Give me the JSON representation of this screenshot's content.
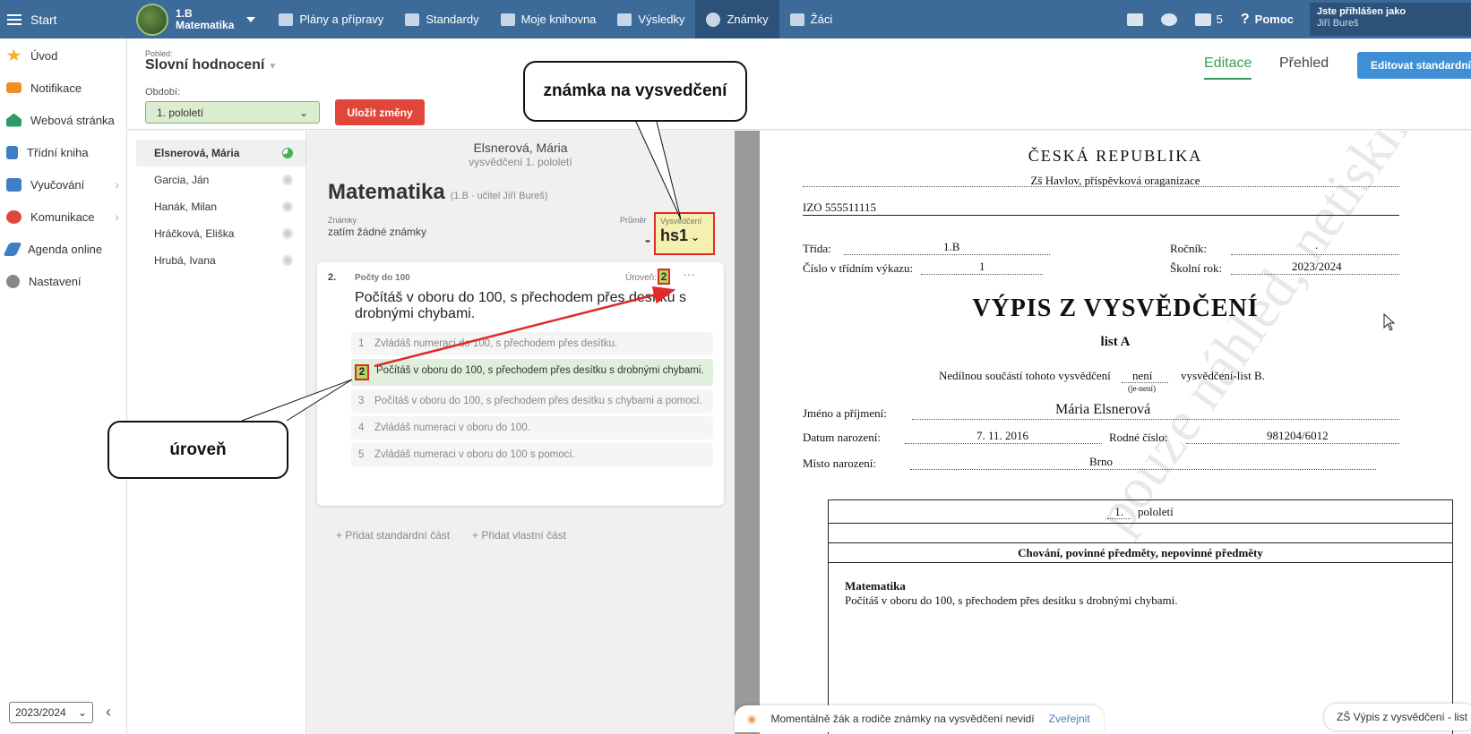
{
  "topbar": {
    "start": "Start",
    "class_name": "1.B",
    "class_subject": "Matematika",
    "nav": [
      {
        "label": "Plány a přípravy",
        "icon": "calendar-icon"
      },
      {
        "label": "Standardy",
        "icon": "shield-icon"
      },
      {
        "label": "Moje knihovna",
        "icon": "library-icon"
      },
      {
        "label": "Výsledky",
        "icon": "bar-chart-icon"
      },
      {
        "label": "Známky",
        "icon": "grade-icon"
      },
      {
        "label": "Žáci",
        "icon": "students-icon"
      }
    ],
    "messages_count": "5",
    "help": "Pomoc",
    "user_label": "Jste přihlášen jako",
    "user_name": "Jiří Bureš"
  },
  "sidebar": {
    "items": [
      {
        "label": "Úvod",
        "icon": "star-icon",
        "color": "#f0b429"
      },
      {
        "label": "Notifikace",
        "icon": "envelope-icon",
        "color": "#f08c2a"
      },
      {
        "label": "Webová stránka",
        "icon": "home-icon",
        "color": "#2e9a6a"
      },
      {
        "label": "Třídní kniha",
        "icon": "book-icon",
        "color": "#3f7fc6"
      },
      {
        "label": "Vyučování",
        "icon": "open-book-icon",
        "color": "#3f7fc6"
      },
      {
        "label": "Komunikace",
        "icon": "chat-icon",
        "color": "#e0463a"
      },
      {
        "label": "Agenda online",
        "icon": "pen-icon",
        "color": "#3f7fc6"
      },
      {
        "label": "Nastavení",
        "icon": "gear-icon",
        "color": "#888888"
      }
    ],
    "year": "2023/2024"
  },
  "header": {
    "view_label": "Pohled:",
    "view_value": "Slovní hodnocení",
    "period_label": "Období:",
    "period_value": "1. pololetí",
    "save": "Uložit změny",
    "tab_edit": "Editace",
    "tab_overview": "Přehled",
    "edit_standard": "Editovat standardní te"
  },
  "students": [
    {
      "name": "Elsnerová, Mária",
      "active": true
    },
    {
      "name": "Garcia, Ján",
      "active": false
    },
    {
      "name": "Hanák, Milan",
      "active": false
    },
    {
      "name": "Hráčková, Eliška",
      "active": false
    },
    {
      "name": "Hrubá, Ivana",
      "active": false
    }
  ],
  "middle": {
    "student_name": "Elsnerová, Mária",
    "subtitle": "vysvědčení 1. pololetí",
    "subject": "Matematika",
    "subject_info": "(1.B · učitel Jiří Bureš)",
    "grades_label": "Známky",
    "grades_value": "zatím žádné známky",
    "avg_label": "Průměr",
    "avg_value": "-",
    "cert_label": "Vysvědčení",
    "cert_value": "hs1",
    "card": {
      "number": "2.",
      "category": "Počty do 100",
      "level_label": "Úroveň:",
      "level_value": "2",
      "more": "···",
      "description": "Počítáš v oboru do 100, s přechodem přes desítku s drobnými chybami.",
      "options": [
        {
          "n": "1",
          "text": "Zvládáš numeraci do 100, s přechodem přes desítku.",
          "selected": false
        },
        {
          "n": "2",
          "text": "Počítáš v oboru do 100, s přechodem přes desítku s drobnými chybami.",
          "selected": true
        },
        {
          "n": "3",
          "text": "Počítáš v oboru do 100, s přechodem přes desítku s chybami a pomocí.",
          "selected": false
        },
        {
          "n": "4",
          "text": "Zvládáš numeraci v oboru do 100.",
          "selected": false
        },
        {
          "n": "5",
          "text": "Zvládáš numeraci v oboru do 100 s pomocí.",
          "selected": false
        }
      ]
    },
    "add_standard": "+ Přidat standardní část",
    "add_own": "+ Přidat vlastní část"
  },
  "document": {
    "country": "ČESKÁ REPUBLIKA",
    "school": "Zš Havlov, příspěvková oraganizace",
    "izo": "IZO  555511115",
    "class_label": "Třída:",
    "class_value": "1.B",
    "grade_label": "Ročník:",
    "grade_value": ".",
    "register_label": "Číslo v třídním výkazu:",
    "register_value": "1",
    "year_label": "Školní rok:",
    "year_value": "2023/2024",
    "title": "VÝPIS Z VYSVĚDČENÍ",
    "list": "list A",
    "part_text_1": "Nedílnou součástí tohoto vysvědčení",
    "part_value": "není",
    "part_hint": "(je-není)",
    "part_text_2": "vysvědčení-list B.",
    "name_label": "Jméno a příjmení:",
    "name_value": "Mária Elsnerová",
    "birth_label": "Datum narození:",
    "birth_value": "7. 11. 2016",
    "rc_label": "Rodné číslo:",
    "rc_value": "981204/6012",
    "place_label": "Místo narození:",
    "place_value": "Brno",
    "period_num": "1.",
    "period_word": "pololetí",
    "section": "Chování, povinné předměty, nepovinné předměty",
    "subject": "Matematika",
    "subject_text": "Počítáš v oboru do 100, s přechodem přes desítku s drobnými chybami.",
    "watermark": "pouze náhled, netisknout"
  },
  "notice": {
    "text": "Momentálně žák a rodiče známky na vysvědčení nevidí",
    "link": "Zveřejnit"
  },
  "doc_name": "ZŠ Výpis z vysvědčení - list",
  "callouts": {
    "grade": "známka na vysvedčení",
    "level": "úroveň"
  }
}
